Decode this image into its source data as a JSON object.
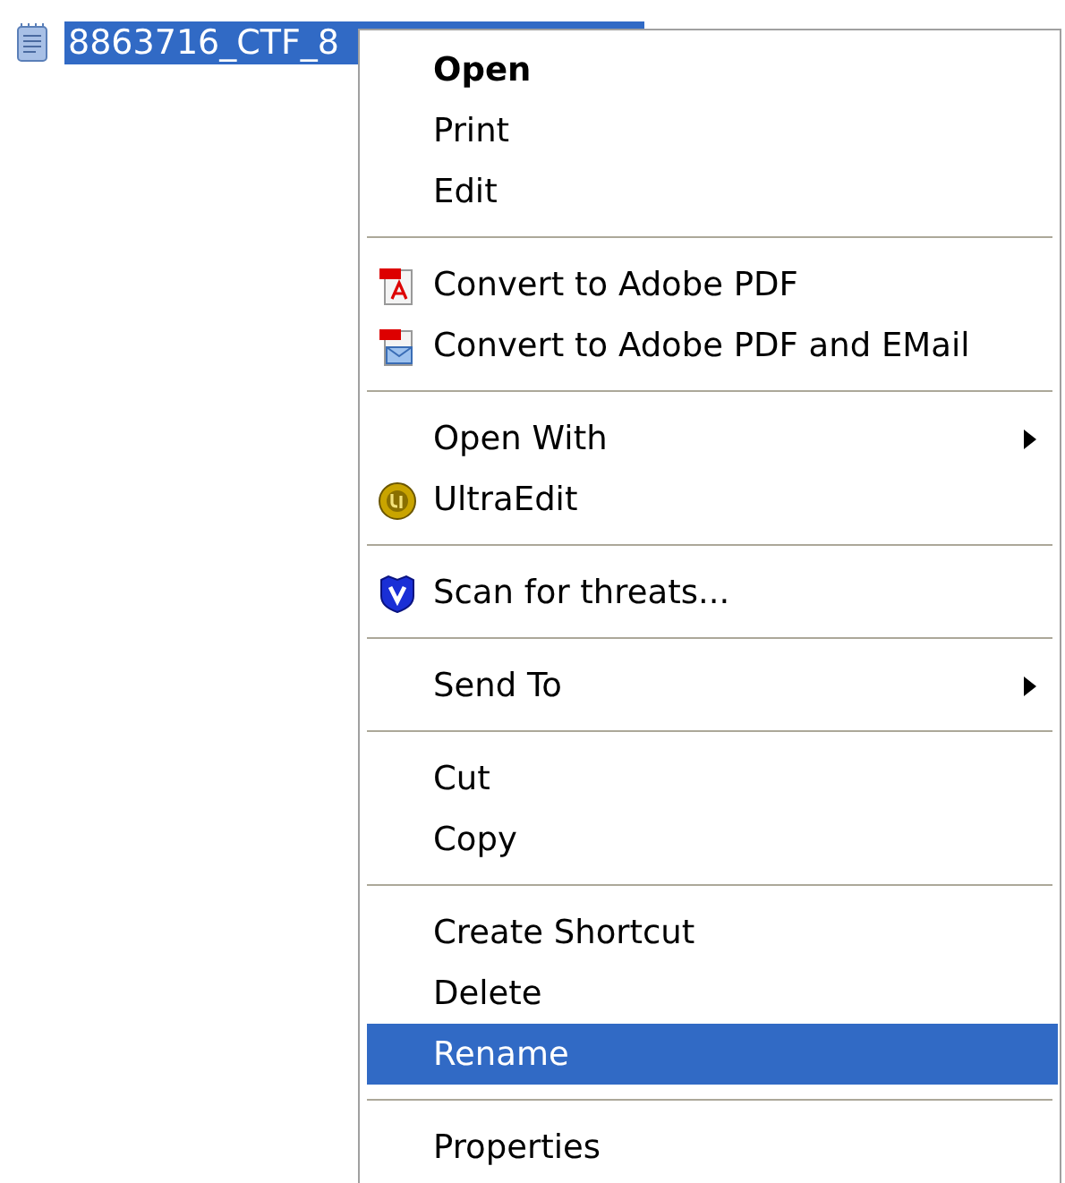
{
  "file": {
    "name": "8863716_CTF_8",
    "selected": true
  },
  "context_menu": {
    "items": [
      {
        "kind": "item",
        "label": "Open",
        "default": true,
        "submenu": false,
        "selected": false
      },
      {
        "kind": "item",
        "label": "Print",
        "default": false,
        "submenu": false,
        "selected": false
      },
      {
        "kind": "item",
        "label": "Edit",
        "default": false,
        "submenu": false,
        "selected": false
      },
      {
        "kind": "separator"
      },
      {
        "kind": "pdf",
        "label": "Convert to Adobe PDF",
        "default": false,
        "submenu": false,
        "selected": false
      },
      {
        "kind": "pdfmail",
        "label": "Convert to Adobe PDF and EMail",
        "default": false,
        "submenu": false,
        "selected": false
      },
      {
        "kind": "separator"
      },
      {
        "kind": "item",
        "label": "Open With",
        "default": false,
        "submenu": true,
        "selected": false
      },
      {
        "kind": "ultraedit",
        "label": "UltraEdit",
        "default": false,
        "submenu": false,
        "selected": false
      },
      {
        "kind": "separator"
      },
      {
        "kind": "shield",
        "label": "Scan for threats...",
        "default": false,
        "submenu": false,
        "selected": false
      },
      {
        "kind": "separator"
      },
      {
        "kind": "item",
        "label": "Send To",
        "default": false,
        "submenu": true,
        "selected": false
      },
      {
        "kind": "separator"
      },
      {
        "kind": "item",
        "label": "Cut",
        "default": false,
        "submenu": false,
        "selected": false
      },
      {
        "kind": "item",
        "label": "Copy",
        "default": false,
        "submenu": false,
        "selected": false
      },
      {
        "kind": "separator"
      },
      {
        "kind": "item",
        "label": "Create Shortcut",
        "default": false,
        "submenu": false,
        "selected": false
      },
      {
        "kind": "item",
        "label": "Delete",
        "default": false,
        "submenu": false,
        "selected": false
      },
      {
        "kind": "item",
        "label": "Rename",
        "default": false,
        "submenu": false,
        "selected": true
      },
      {
        "kind": "separator"
      },
      {
        "kind": "item",
        "label": "Properties",
        "default": false,
        "submenu": false,
        "selected": false
      }
    ]
  }
}
